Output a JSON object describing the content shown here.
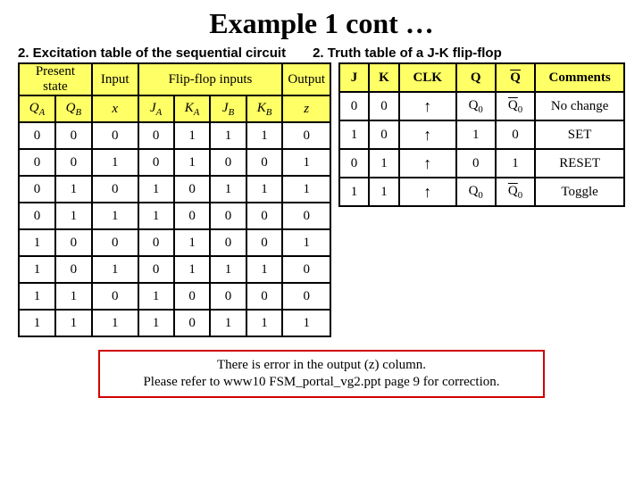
{
  "title": "Example 1 cont …",
  "subtitle_left": "2. Excitation table of the sequential circuit",
  "subtitle_right": "2. Truth table of a J-K flip-flop",
  "excite": {
    "header_groups": {
      "present_state": "Present state",
      "input": "Input",
      "ff_inputs": "Flip-flop inputs",
      "output": "Output"
    },
    "cols": {
      "QA": "Q",
      "QA_sub": "A",
      "QB": "Q",
      "QB_sub": "B",
      "x": "x",
      "JA": "J",
      "JA_sub": "A",
      "KA": "K",
      "KA_sub": "A",
      "JB": "J",
      "JB_sub": "B",
      "KB": "K",
      "KB_sub": "B",
      "z": "z"
    },
    "rows": [
      [
        "0",
        "0",
        "0",
        "0",
        "1",
        "1",
        "1",
        "0"
      ],
      [
        "0",
        "0",
        "1",
        "0",
        "1",
        "0",
        "0",
        "1"
      ],
      [
        "0",
        "1",
        "0",
        "1",
        "0",
        "1",
        "1",
        "1"
      ],
      [
        "0",
        "1",
        "1",
        "1",
        "0",
        "0",
        "0",
        "0"
      ],
      [
        "1",
        "0",
        "0",
        "0",
        "1",
        "0",
        "0",
        "1"
      ],
      [
        "1",
        "0",
        "1",
        "0",
        "1",
        "1",
        "1",
        "0"
      ],
      [
        "1",
        "1",
        "0",
        "1",
        "0",
        "0",
        "0",
        "0"
      ],
      [
        "1",
        "1",
        "1",
        "1",
        "0",
        "1",
        "1",
        "1"
      ]
    ]
  },
  "truth": {
    "headers": {
      "J": "J",
      "K": "K",
      "CLK": "CLK",
      "Q": "Q",
      "Qbar": "Q",
      "Comments": "Comments"
    },
    "arrow": "↑",
    "rows": [
      {
        "J": "0",
        "K": "0",
        "Q": "Q",
        "Qsub": "0",
        "Qbar": "Q",
        "Qbarsub": "0",
        "comment": "No change"
      },
      {
        "J": "1",
        "K": "0",
        "Q": "1",
        "Qsub": "",
        "Qbar": "0",
        "Qbarsub": "",
        "comment": "SET"
      },
      {
        "J": "0",
        "K": "1",
        "Q": "0",
        "Qsub": "",
        "Qbar": "1",
        "Qbarsub": "",
        "comment": "RESET"
      },
      {
        "J": "1",
        "K": "1",
        "Q": "Q",
        "Qsub": "0",
        "Qbar": "Q",
        "Qbarsub": "0",
        "comment": "Toggle"
      }
    ]
  },
  "error_note": {
    "line1": "There is error in the output (z) column.",
    "line2": "Please refer to www10 FSM_portal_vg2.ppt page 9 for correction."
  }
}
